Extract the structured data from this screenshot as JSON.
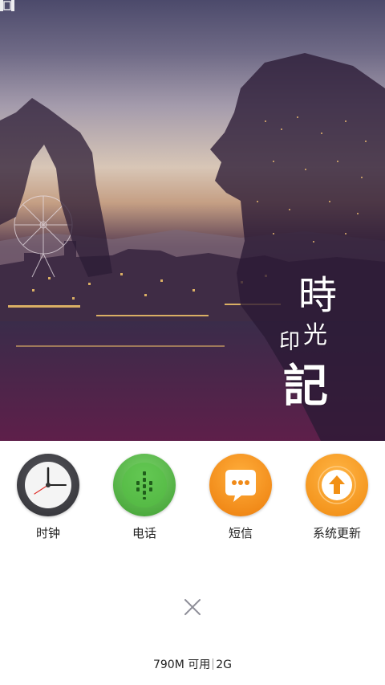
{
  "wallpaper": {
    "calligraphy": [
      "時",
      "光",
      "印",
      "記"
    ]
  },
  "apps": [
    {
      "label": "时钟",
      "icon": "clock-icon",
      "color": "#3b3b3f"
    },
    {
      "label": "电话",
      "icon": "phone-icon",
      "color": "#4caf3d"
    },
    {
      "label": "短信",
      "icon": "message-icon",
      "color": "#f28a16"
    },
    {
      "label": "系统更新",
      "icon": "system-update-icon",
      "color": "#f59a14"
    }
  ],
  "memory": {
    "available": "790M 可用",
    "total": "2G"
  }
}
